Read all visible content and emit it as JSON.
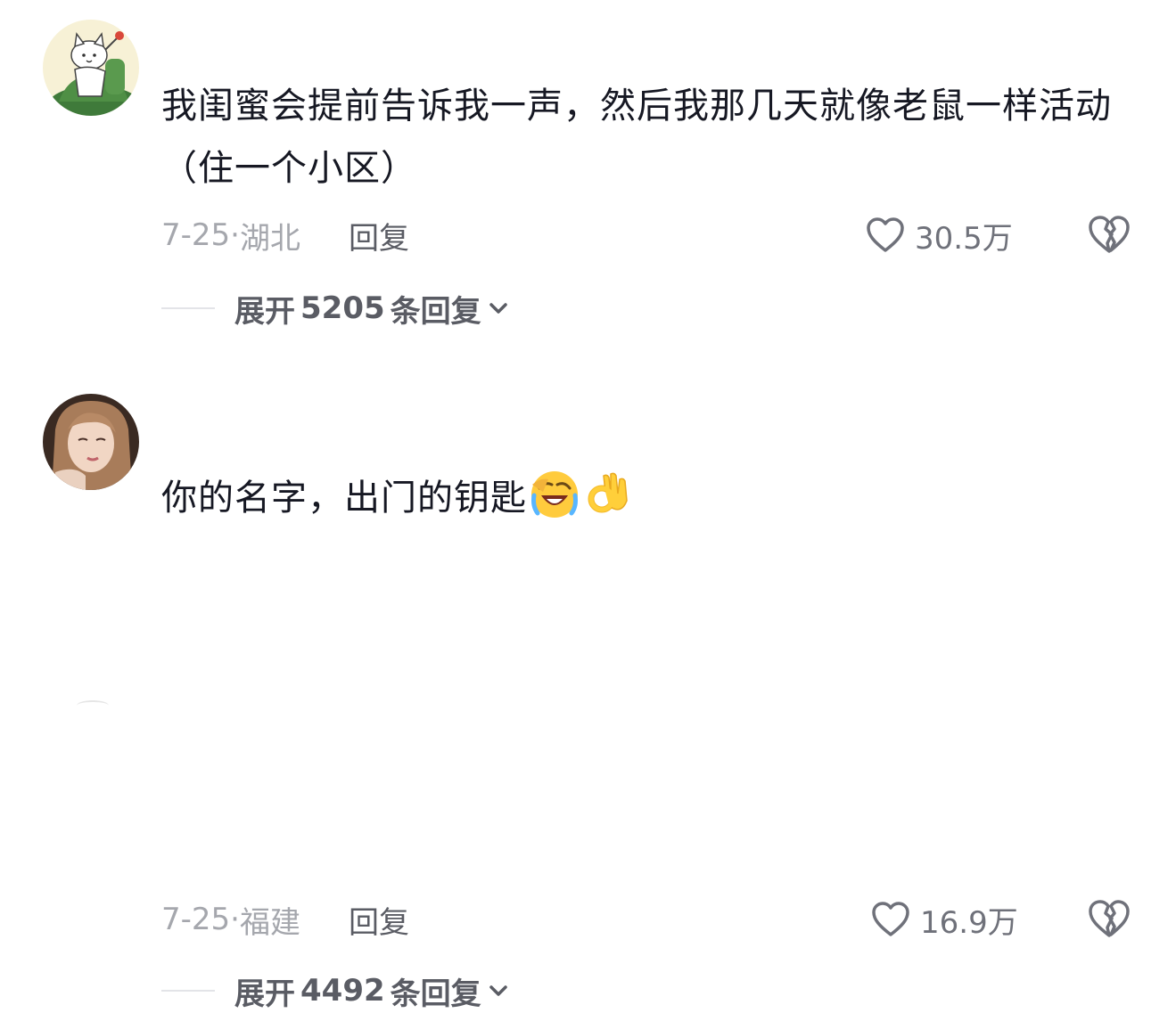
{
  "comments": [
    {
      "avatar": "cat-avatar",
      "text": "我闺蜜会提前告诉我一声，然后我那几天就像老鼠一样活动（住一个小区）",
      "date": "7-25",
      "sep": "·",
      "location": "湖北",
      "reply_label": "回复",
      "likes": "30.5万",
      "expand": {
        "prefix": "展开",
        "count": "5205",
        "suffix": "条回复"
      }
    },
    {
      "avatar": "girl-avatar",
      "text": "你的名字，出门的钥匙",
      "emojis": [
        "rofl-emoji",
        "ok-hand-emoji"
      ],
      "date": "7-25",
      "sep": "·",
      "location": "福建",
      "reply_label": "回复",
      "likes": "16.9万",
      "expand": {
        "prefix": "展开",
        "count": "4492",
        "suffix": "条回复"
      }
    }
  ],
  "colors": {
    "text": "#161823",
    "meta": "#a5a7ad",
    "secondary": "#5a5c64",
    "icon": "#6f717a"
  }
}
